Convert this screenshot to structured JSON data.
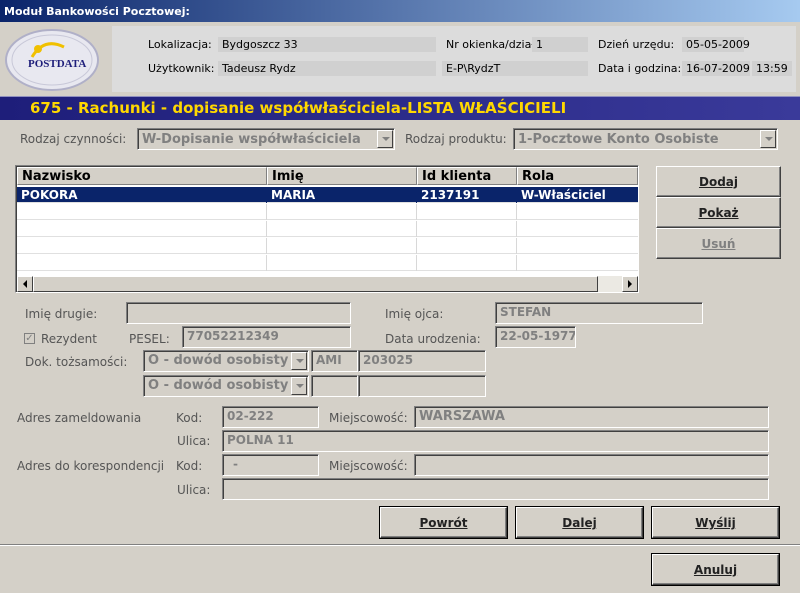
{
  "window": {
    "title": "Moduł Bankowości Pocztowej:"
  },
  "logo": {
    "text": "POSTDATA"
  },
  "info": {
    "lokalizacja_label": "Lokalizacja:",
    "lokalizacja_value": "Bydgoszcz 33",
    "uzytkownik_label": "Użytkownik:",
    "uzytkownik_value": "Tadeusz Rydz",
    "okienko_label": "Nr okienka/dział:",
    "okienko_value": "1",
    "login_value": "E-P\\RydzT",
    "dzien_label": "Dzień urzędu:",
    "dzien_value": "05-05-2009",
    "data_label": "Data i godzina:",
    "data_value": "16-07-2009",
    "godzina_value": "13:59"
  },
  "section_title": "675 - Rachunki - dopisanie współwłaściciela-LISTA WŁAŚCICIELI",
  "filters": {
    "rodzaj_czynnosci_label": "Rodzaj czynności:",
    "rodzaj_czynnosci_value": "W-Dopisanie współwłaściciela",
    "rodzaj_produktu_label": "Rodzaj produktu:",
    "rodzaj_produktu_value": "1-Pocztowe Konto Osobiste"
  },
  "table": {
    "headers": [
      "Nazwisko",
      "Imię",
      "Id klienta",
      "Rola"
    ],
    "rows": [
      [
        "POKORA",
        "MARIA",
        "2137191",
        "W-Właściciel"
      ]
    ]
  },
  "side_buttons": {
    "dodaj": "Dodaj",
    "pokaz": "Pokaż",
    "usun": "Usuń"
  },
  "details": {
    "imie_drugie_label": "Imię drugie:",
    "imie_drugie_value": "",
    "imie_ojca_label": "Imię ojca:",
    "imie_ojca_value": "STEFAN",
    "rezydent_label": "Rezydent",
    "rezydent_checked": "✓",
    "pesel_label": "PESEL:",
    "pesel_value": "77052212349",
    "data_urodzenia_label": "Data urodzenia:",
    "data_urodzenia_value": "22-05-1977",
    "dok_label": "Dok. tożsamości:",
    "dok1_type": "O - dowód osobisty",
    "dok1_series": "AMI",
    "dok1_number": "203025",
    "dok2_type": "O - dowód osobisty",
    "dok2_series": "",
    "dok2_number": ""
  },
  "address": {
    "zameldowania_label": "Adres zameldowania",
    "kod_label": "Kod:",
    "kod_value": "02-222",
    "miejscowosc_label": "Miejscowość:",
    "miejscowosc_value": "WARSZAWA",
    "ulica_label": "Ulica:",
    "ulica_value": "POLNA 11",
    "koresp_label": "Adres do korespondencji",
    "koresp_kod_label": "Kod:",
    "koresp_kod_value": "-",
    "koresp_miejscowosc_label": "Miejscowość:",
    "koresp_miejscowosc_value": "",
    "koresp_ulica_label": "Ulica:",
    "koresp_ulica_value": ""
  },
  "bottom_buttons": {
    "powrot": "Powrót",
    "dalej": "Dalej",
    "wyslij": "Wyślij",
    "anuluj": "Anuluj"
  },
  "colors": {
    "title_bar": "#0a246a",
    "section_header": "#1e1e7a",
    "section_text": "#ffd800",
    "selection": "#0a246a"
  }
}
